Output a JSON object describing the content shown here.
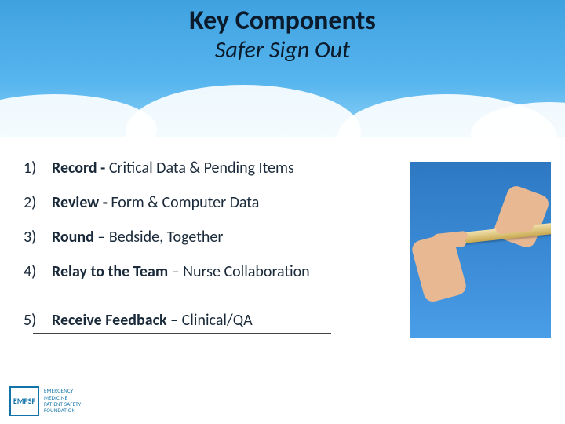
{
  "title": "Key Components",
  "subtitle": "Safer Sign Out",
  "items": [
    {
      "num": "1)",
      "bold": "Record - ",
      "rest": " Critical Data & Pending Items"
    },
    {
      "num": "2)",
      "bold": "Review - ",
      "rest": "Form & Computer Data"
    },
    {
      "num": "3)",
      "bold": "Round",
      "rest": " – Bedside, Together"
    },
    {
      "num": "4)",
      "bold": "Relay to the Team",
      "rest": " – Nurse Collaboration"
    },
    {
      "num": "5)",
      "bold": "Receive Feedback",
      "rest": " – Clinical/QA"
    }
  ],
  "logo": {
    "abbr": "EMPSF",
    "line1": "EMERGENCY",
    "line2": "MEDICINE",
    "line3": "PATIENT SAFETY",
    "line4": "FOUNDATION"
  }
}
